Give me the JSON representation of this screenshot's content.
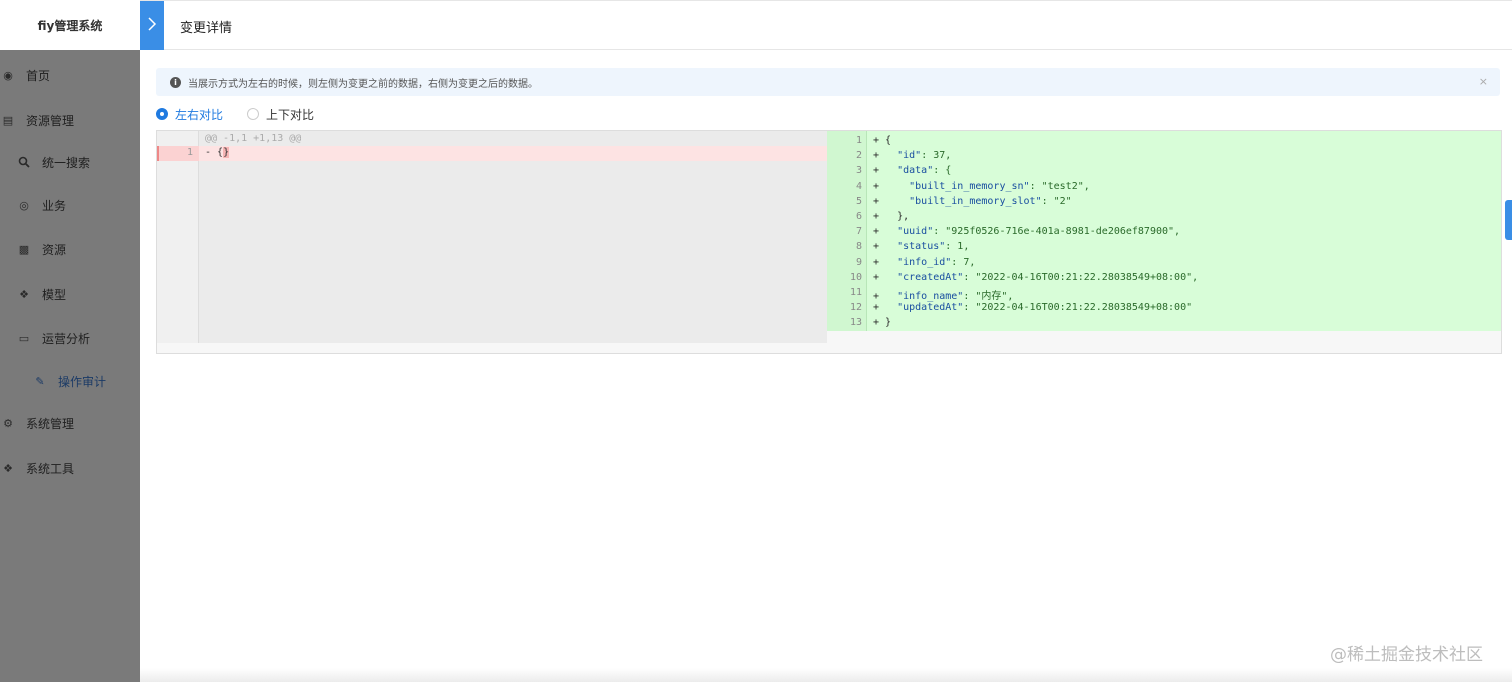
{
  "sidebar": {
    "logo": "fiy管理系统",
    "items": [
      {
        "label": "首页",
        "icon": "dashboard-icon"
      },
      {
        "label": "资源管理",
        "icon": "database-icon"
      },
      {
        "label": "统一搜索",
        "icon": "search-icon"
      },
      {
        "label": "业务",
        "icon": "business-icon"
      },
      {
        "label": "资源",
        "icon": "resource-icon"
      },
      {
        "label": "模型",
        "icon": "model-icon"
      },
      {
        "label": "运营分析",
        "icon": "monitor-icon"
      },
      {
        "label": "操作审计",
        "icon": "audit-icon"
      },
      {
        "label": "系统管理",
        "icon": "settings-icon"
      },
      {
        "label": "系统工具",
        "icon": "tools-icon"
      }
    ]
  },
  "header": {
    "toggle_icon": "chevron-right-icon",
    "title": "变更详情"
  },
  "alert": {
    "icon": "info-icon",
    "text": "当展示方式为左右的时候，则左侧为变更之前的数据，右侧为变更之后的数据。",
    "close": "×"
  },
  "view_mode": {
    "options": [
      "左右对比",
      "上下对比"
    ],
    "selected": "左右对比"
  },
  "diff": {
    "hunk_header": "@@ -1,1 +1,13 @@",
    "left": {
      "num": "1",
      "prefix": "- {",
      "highlight": "}"
    },
    "right_lines": [
      {
        "num": "1",
        "plus": "+",
        "text": " {"
      },
      {
        "num": "2",
        "plus": "+",
        "indent": "   ",
        "key": "\"id\"",
        "rest": ": 37,"
      },
      {
        "num": "3",
        "plus": "+",
        "indent": "   ",
        "key": "\"data\"",
        "rest": ": {"
      },
      {
        "num": "4",
        "plus": "+",
        "indent": "     ",
        "key": "\"built_in_memory_sn\"",
        "rest": ": \"test2\","
      },
      {
        "num": "5",
        "plus": "+",
        "indent": "     ",
        "key": "\"built_in_memory_slot\"",
        "rest": ": \"2\""
      },
      {
        "num": "6",
        "plus": "+",
        "text": "   },"
      },
      {
        "num": "7",
        "plus": "+",
        "indent": "   ",
        "key": "\"uuid\"",
        "rest": ": \"925f0526-716e-401a-8981-de206ef87900\","
      },
      {
        "num": "8",
        "plus": "+",
        "indent": "   ",
        "key": "\"status\"",
        "rest": ": 1,"
      },
      {
        "num": "9",
        "plus": "+",
        "indent": "   ",
        "key": "\"info_id\"",
        "rest": ": 7,"
      },
      {
        "num": "10",
        "plus": "+",
        "indent": "   ",
        "key": "\"createdAt\"",
        "rest": ": \"2022-04-16T00:21:22.28038549+08:00\","
      },
      {
        "num": "11",
        "plus": "+",
        "indent": "   ",
        "key": "\"info_name\"",
        "rest": ": \"内存\","
      },
      {
        "num": "12",
        "plus": "+",
        "indent": "   ",
        "key": "\"updatedAt\"",
        "rest": ": \"2022-04-16T00:21:22.28038549+08:00\""
      },
      {
        "num": "13",
        "plus": "+",
        "text": " }"
      }
    ]
  },
  "watermark": "@稀土掘金技术社区",
  "colors": {
    "accent": "#1f7ae0",
    "toggle": "#3a8ee6",
    "sidebar_bg": "#7a7a7a",
    "added_bg": "#d8fdd8",
    "removed_bg": "#fde3e3"
  }
}
